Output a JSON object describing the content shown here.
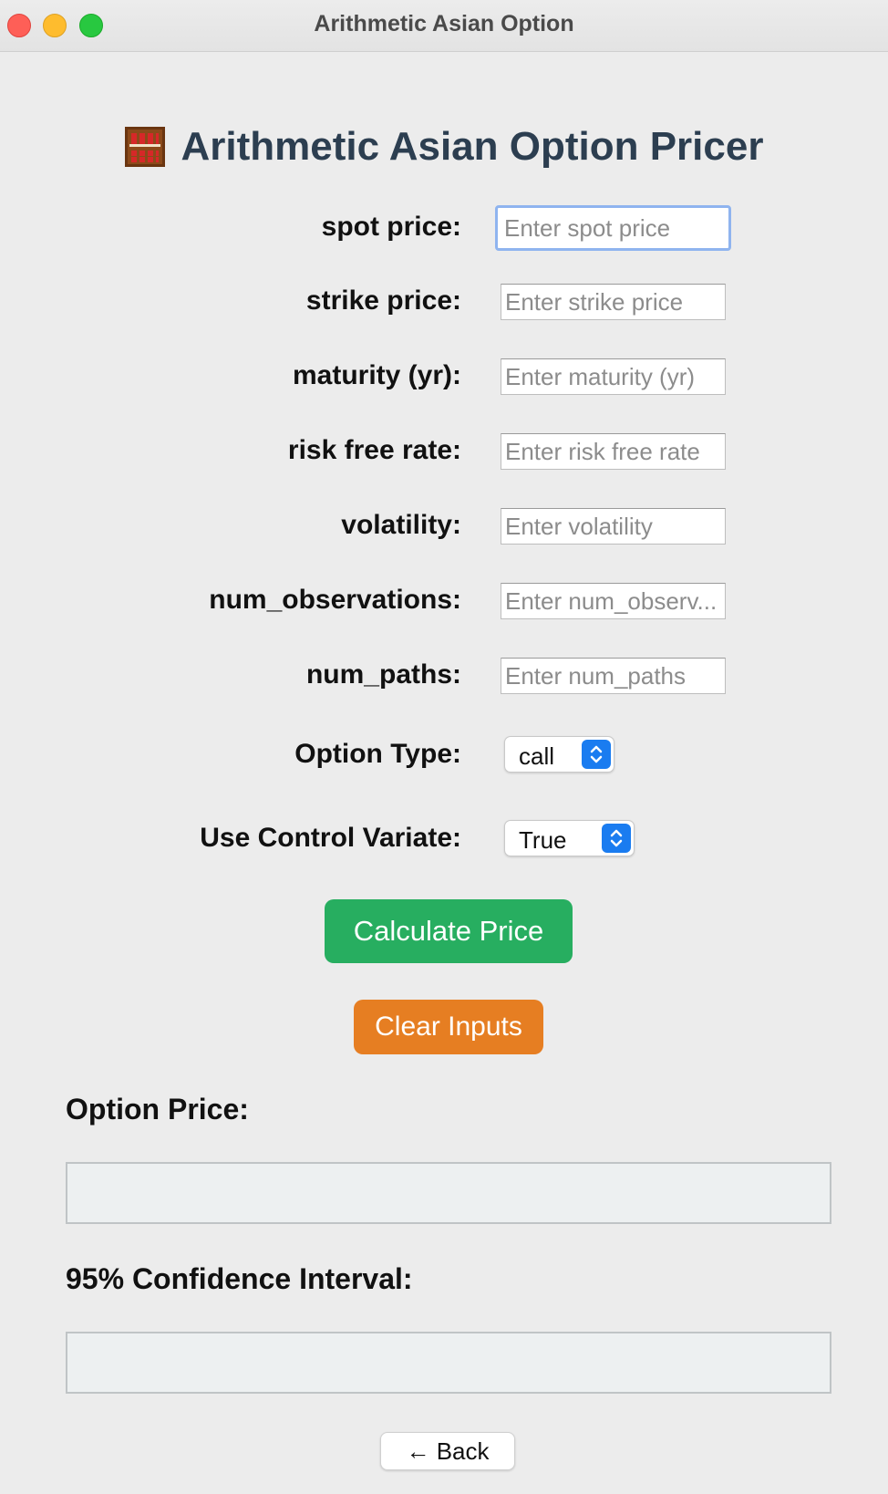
{
  "window": {
    "title": "Arithmetic Asian Option"
  },
  "heading": {
    "icon": "abacus-icon",
    "text": "Arithmetic Asian Option Pricer"
  },
  "fields": [
    {
      "label": "spot price:",
      "placeholder": "Enter spot price"
    },
    {
      "label": "strike price:",
      "placeholder": "Enter strike price"
    },
    {
      "label": "maturity (yr):",
      "placeholder": "Enter maturity (yr)"
    },
    {
      "label": "risk free rate:",
      "placeholder": "Enter risk free rate"
    },
    {
      "label": "volatility:",
      "placeholder": "Enter volatility"
    },
    {
      "label": "num_observations:",
      "placeholder": "Enter num_observ..."
    },
    {
      "label": "num_paths:",
      "placeholder": "Enter num_paths"
    }
  ],
  "option_type": {
    "label": "Option Type:",
    "value": "call"
  },
  "control_variate": {
    "label": "Use Control Variate:",
    "value": "True"
  },
  "buttons": {
    "calculate": "Calculate Price",
    "clear": "Clear Inputs",
    "back": "← Back"
  },
  "results": {
    "price_label": "Option Price:",
    "price_value": "",
    "ci_label": "95% Confidence Interval:",
    "ci_value": ""
  },
  "colors": {
    "heading": "#2c3e50",
    "calculate": "#27ae60",
    "clear": "#e67e22",
    "select_accent": "#1a7cf0",
    "focus_ring": "#8fb4ef"
  }
}
